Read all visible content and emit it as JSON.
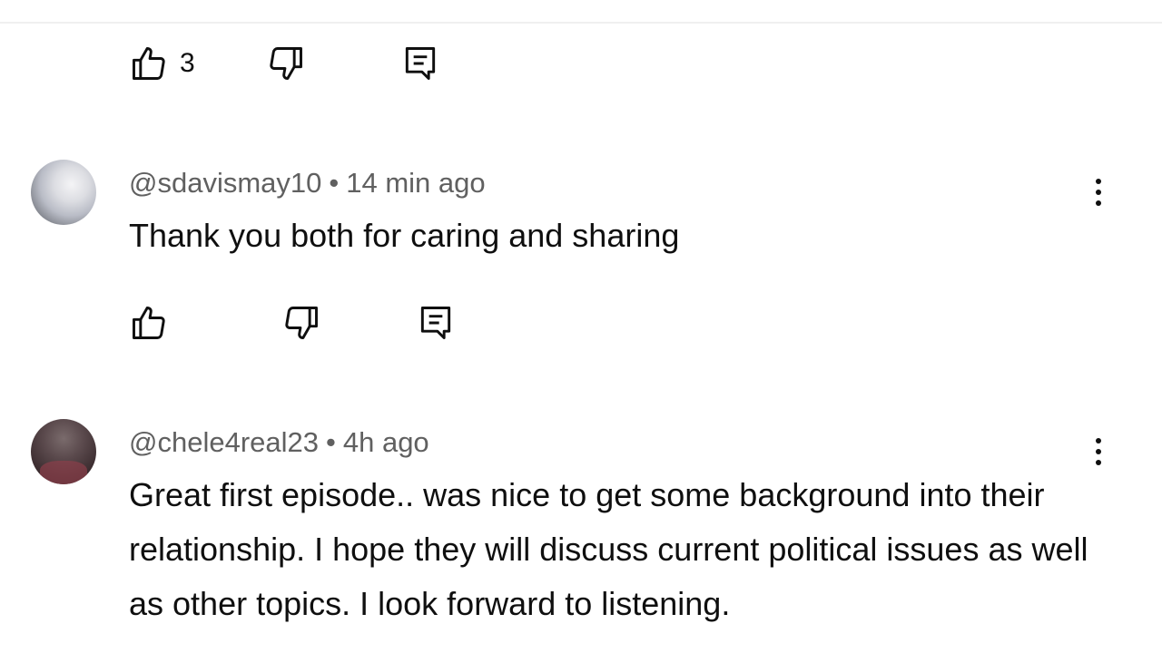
{
  "previous_comment": {
    "actions": {
      "like_count": "3"
    }
  },
  "comments": [
    {
      "author": "@sdavismay10",
      "separator": "•",
      "time": "14 min ago",
      "text": "Thank you both for caring and sharing",
      "like_count": ""
    },
    {
      "author": "@chele4real23",
      "separator": "•",
      "time": "4h ago",
      "text": "Great first episode.. was nice to get some background into their relationship. I hope they will discuss current political issues as well as other topics. I look forward to listening.",
      "like_count": ""
    }
  ],
  "icons": {
    "like": "thumbs-up-icon",
    "dislike": "thumbs-down-icon",
    "reply": "reply-icon",
    "more": "more-vert-icon"
  },
  "colors": {
    "text_primary": "#0f0f0f",
    "text_secondary": "#606060",
    "divider": "#f0f0f0"
  }
}
